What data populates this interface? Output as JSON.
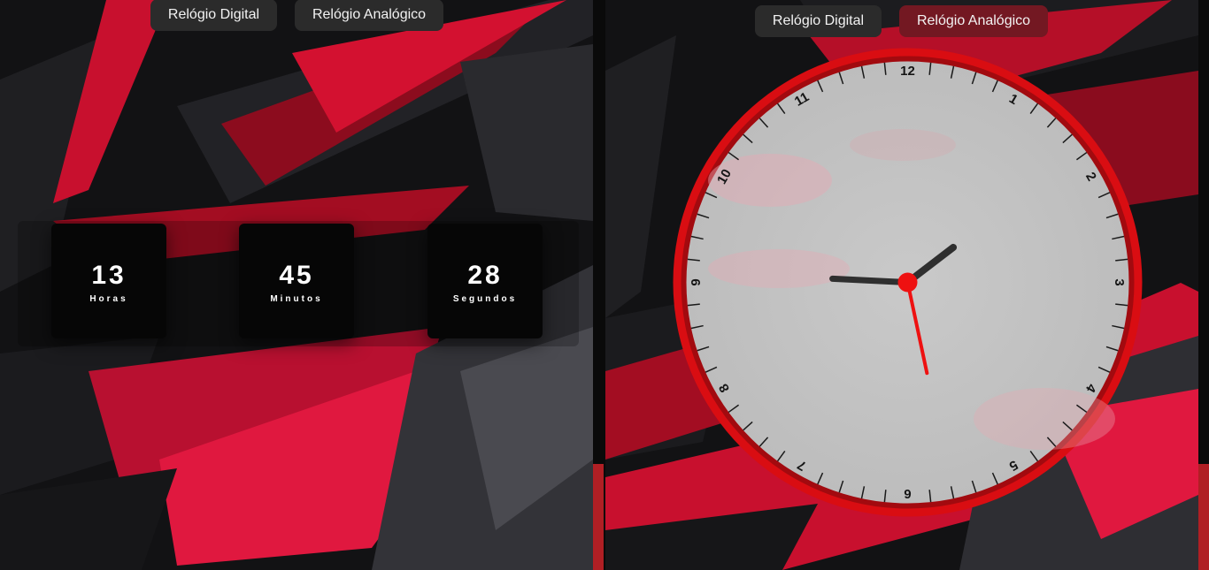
{
  "left_pane": {
    "buttons": [
      {
        "label": "Relógio Digital"
      },
      {
        "label": "Relógio Analógico"
      }
    ],
    "digital_clock": {
      "hours": {
        "value": "13",
        "label": "Horas"
      },
      "minutes": {
        "value": "45",
        "label": "Minutos"
      },
      "seconds": {
        "value": "28",
        "label": "Segundos"
      }
    }
  },
  "right_pane": {
    "buttons": [
      {
        "label": "Relógio Digital",
        "active": false
      },
      {
        "label": "Relógio Analógico",
        "active": true
      }
    ],
    "analog_clock": {
      "numbers": [
        "12",
        "1",
        "2",
        "3",
        "4",
        "5",
        "6",
        "7",
        "8",
        "9",
        "10",
        "11"
      ],
      "time": {
        "hours": 13,
        "minutes": 45,
        "seconds": 28
      },
      "colors": {
        "rim": "#d90d12",
        "face": "#c4c4c4",
        "hands": "#2f2f2f",
        "second_hand": "#ee1111"
      }
    }
  },
  "theme": {
    "accent": "#d90d12",
    "active_button": "#731822",
    "button": "#2b2b2b"
  }
}
